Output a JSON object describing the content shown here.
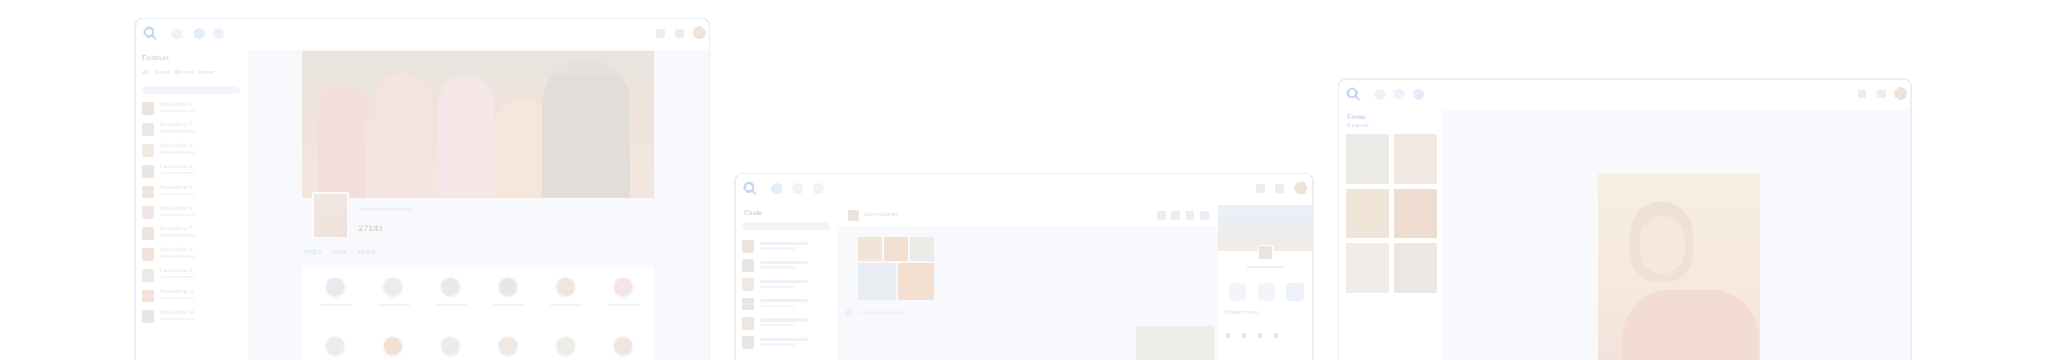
{
  "window1": {
    "sidebar_title": "Rostrum",
    "sidebar_tabs": [
      "All",
      "Faces",
      "Albums",
      "Shared"
    ],
    "people": [
      {
        "name": "Faces Group 1"
      },
      {
        "name": "Faces Group 2"
      },
      {
        "name": "Faces Group 3"
      },
      {
        "name": "Faces Group 4"
      },
      {
        "name": "Faces Group 5"
      },
      {
        "name": "Faces Group 6"
      },
      {
        "name": "Faces Group 7"
      },
      {
        "name": "Faces Group 8"
      },
      {
        "name": "Faces Group 9"
      },
      {
        "name": "Faces Group 10"
      },
      {
        "name": "Faces Group 11"
      }
    ],
    "profile_count": "27143",
    "profile_tabs": [
      "Photos",
      "Faces",
      "Albums"
    ]
  },
  "window2": {
    "sidebar_title": "Chats",
    "header_name": "Conversation",
    "right_panel_title": "Shared media"
  },
  "window3": {
    "sidebar_title": "Faces",
    "sidebar_subtitle": "6 people"
  },
  "colors": {
    "accent": "#4a78e0",
    "window_border": "#e9eef8",
    "background": "#ffffff"
  },
  "icons": {
    "logo": "search-magnifier-logo-icon",
    "nav1": "home-icon",
    "nav2": "people-icon",
    "nav3": "album-icon",
    "settings": "gear-icon"
  }
}
